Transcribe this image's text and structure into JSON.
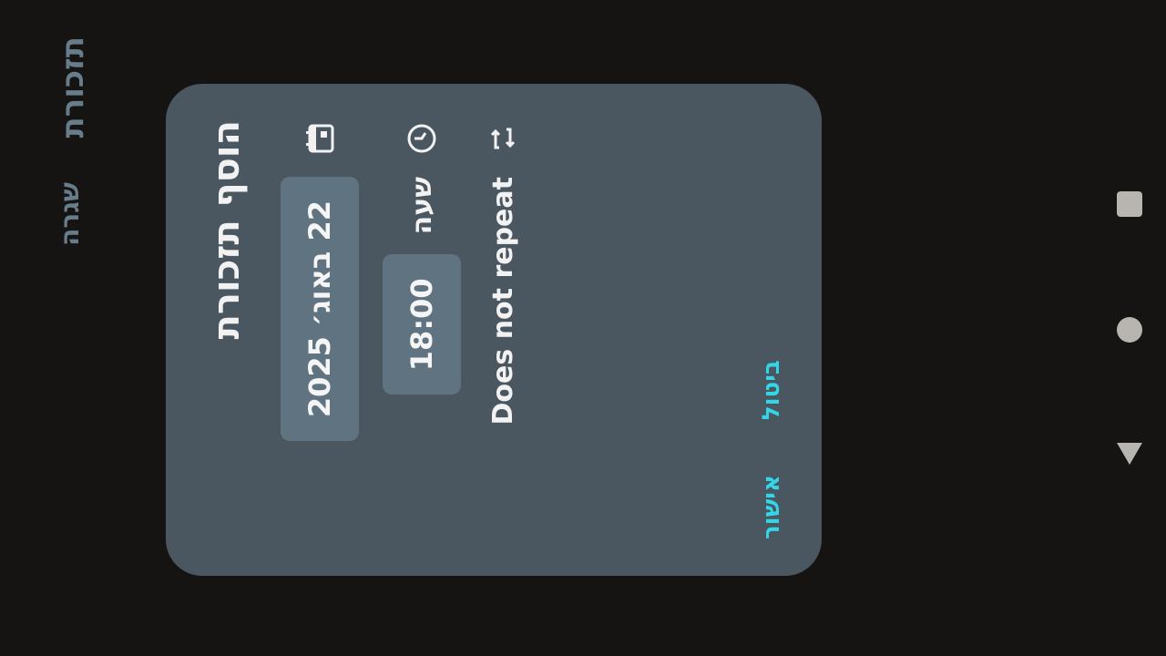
{
  "background": {
    "header_label": "תזכורת",
    "tab_label": "שגרה"
  },
  "dialog": {
    "title": "הוסף תזכורת",
    "date": "22 באוג׳ 2025",
    "time": "18:00",
    "time_label": "שעה",
    "repeat": "Does not repeat",
    "actions": {
      "confirm": "אישור",
      "cancel": "ביטול"
    }
  },
  "icons": {
    "date": "calendar-icon",
    "time": "clock-icon",
    "repeat": "repeat-icon"
  },
  "colors": {
    "dialog_bg": "#4a5660",
    "chip_bg": "#5f7380",
    "accent": "#33d6e6"
  }
}
